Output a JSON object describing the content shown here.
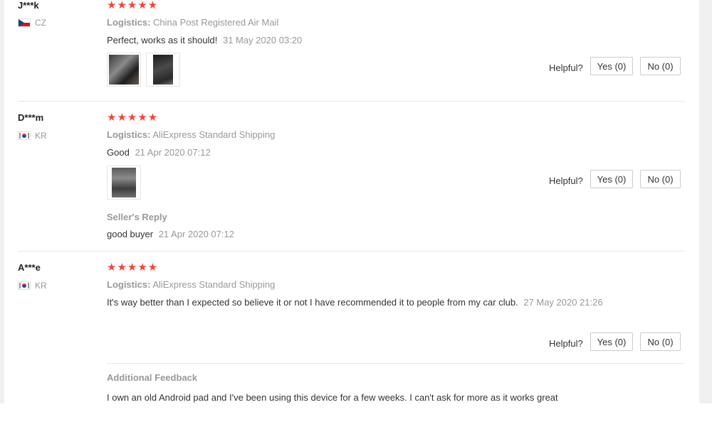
{
  "reviews": [
    {
      "buyer": "J***k",
      "country": "CZ",
      "stars": "★★★★★",
      "logistics_label": "Logistics:",
      "logistics": "China Post Registered Air Mail",
      "text": "Perfect, works as it should!",
      "date": "31 May 2020 03:20",
      "helpful_label": "Helpful?",
      "yes_label": "Yes (0)",
      "no_label": "No (0)"
    },
    {
      "buyer": "D***m",
      "country": "KR",
      "stars": "★★★★★",
      "logistics_label": "Logistics:",
      "logistics": "AliExpress Standard Shipping",
      "text": "Good",
      "date": "21 Apr 2020 07:12",
      "helpful_label": "Helpful?",
      "yes_label": "Yes (0)",
      "no_label": "No (0)",
      "seller_reply_title": "Seller's Reply",
      "seller_reply_text": "good buyer",
      "seller_reply_date": "21 Apr 2020 07:12"
    },
    {
      "buyer": "A***e",
      "country": "KR",
      "stars": "★★★★★",
      "logistics_label": "Logistics:",
      "logistics": "AliExpress Standard Shipping",
      "text": "It's way better than I expected so believe it or not I have recommended it to people from my car club.",
      "date": "27 May 2020 21:26",
      "helpful_label": "Helpful?",
      "yes_label": "Yes (0)",
      "no_label": "No (0)",
      "additional_title": "Additional Feedback",
      "additional_text": "I own an old Android pad and I've been using this device for a few weeks. I can't ask for more as it works great"
    }
  ]
}
